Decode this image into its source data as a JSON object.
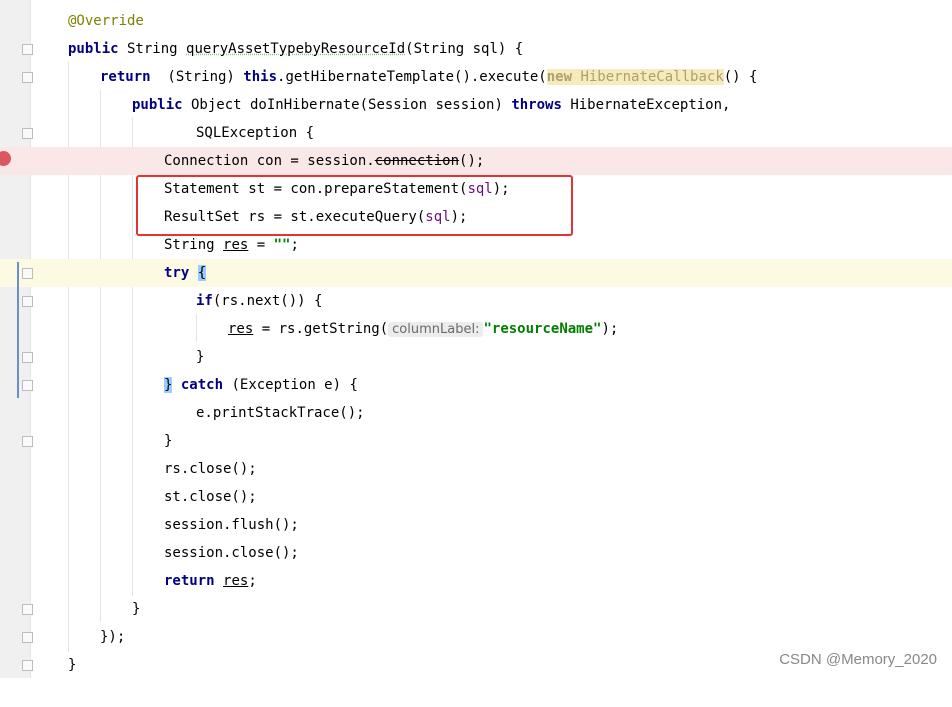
{
  "code": {
    "l1": "@Override",
    "l2_a": "public",
    "l2_b": " String ",
    "l2_c": "queryAssetTypebyResourceId",
    "l2_d": "(String sql) {",
    "l3_a": "return",
    "l3_b": "  (String) ",
    "l3_c": "this",
    "l3_d": ".getHibernateTemplate().execute(",
    "l3_e": "new ",
    "l3_f": "HibernateCallback",
    "l3_g": "() {",
    "l4_a": "public",
    "l4_b": " Object doInHibernate(Session session) ",
    "l4_c": "throws",
    "l4_d": " HibernateException,",
    "l5": "SQLException {",
    "l6_a": "Connection con = session.",
    "l6_b": "connection",
    "l6_c": "();",
    "l7_a": "Statement st = con.prepareStatement(",
    "l7_b": "sql",
    "l7_c": ");",
    "l8_a": "ResultSet rs = st.executeQuery(",
    "l8_b": "sql",
    "l8_c": ");",
    "l9_a": "String ",
    "l9_b": "res",
    "l9_c": " = ",
    "l9_d": "\"\"",
    "l9_e": ";",
    "l10_a": "try",
    "l10_b": " ",
    "l10_c": "{",
    "l11_a": "if",
    "l11_b": "(rs.next()) {",
    "l12_a": "res",
    "l12_b": " = rs.getString(",
    "l12_hint": "columnLabel:",
    "l12_c": "\"resourceName\"",
    "l12_d": ");",
    "l13": "}",
    "l14_a": "}",
    "l14_b": " ",
    "l14_c": "catch",
    "l14_d": " (Exception e) {",
    "l15": "e.printStackTrace();",
    "l16": "}",
    "l17": "rs.close();",
    "l18": "st.close();",
    "l19": "session.flush();",
    "l20": "session.close();",
    "l21_a": "return",
    "l21_b": " ",
    "l21_c": "res",
    "l21_d": ";",
    "l22": "}",
    "l23": "});",
    "l24": "}"
  },
  "watermark": "CSDN @Memory_2020",
  "colors": {
    "keyword": "#000080",
    "annotation": "#808000",
    "param": "#660e7a",
    "string": "#008000",
    "breakpoint": "#db5860",
    "highlight_box": "#e03535"
  }
}
